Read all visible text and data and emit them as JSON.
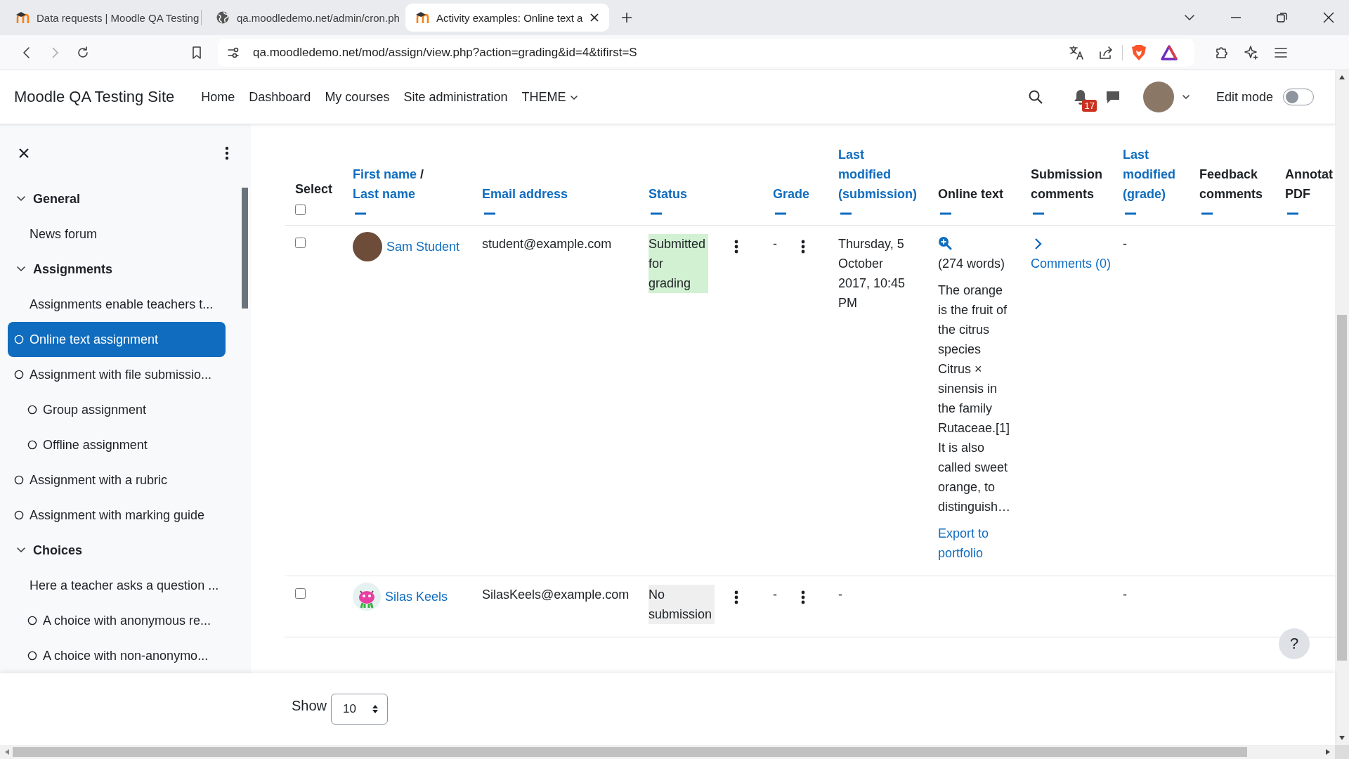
{
  "browser": {
    "tabs": [
      {
        "title": "Data requests | Moodle QA Testing",
        "kind": "moodle",
        "selected": false
      },
      {
        "title": "qa.moodledemo.net/admin/cron.ph",
        "kind": "globe",
        "selected": false
      },
      {
        "title": "Activity examples: Online text a",
        "kind": "moodle",
        "selected": true
      }
    ],
    "url": "qa.moodledemo.net/mod/assign/view.php?action=grading&id=4&tifirst=S"
  },
  "header": {
    "site_name": "Moodle QA Testing Site",
    "nav": [
      {
        "label": "Home",
        "kind": "link"
      },
      {
        "label": "Dashboard",
        "kind": "link"
      },
      {
        "label": "My courses",
        "kind": "link"
      },
      {
        "label": "Site administration",
        "kind": "link"
      },
      {
        "label": "THEME",
        "kind": "dropdown"
      }
    ],
    "notification_count": "17",
    "edit_mode": {
      "label": "Edit mode",
      "on": false
    }
  },
  "sidebar": {
    "items": [
      {
        "label": "General",
        "kind": "section",
        "expanded": true,
        "children": [
          {
            "label": "News forum",
            "kind": "activity",
            "completion": false,
            "selected": false
          }
        ]
      },
      {
        "label": "Assignments",
        "kind": "section",
        "expanded": true,
        "children": [
          {
            "label": "Assignments enable teachers t...",
            "kind": "label",
            "selected": false
          },
          {
            "label": "Online text assignment",
            "kind": "activity",
            "completion": true,
            "selected": true
          },
          {
            "label": "Assignment with file submissio...",
            "kind": "activity",
            "completion": true,
            "selected": false,
            "children": [
              {
                "label": "Group assignment",
                "kind": "activity",
                "completion": true,
                "selected": false
              },
              {
                "label": "Offline assignment",
                "kind": "activity",
                "completion": true,
                "selected": false
              }
            ]
          },
          {
            "label": "Assignment with a rubric",
            "kind": "activity",
            "completion": true,
            "selected": false
          },
          {
            "label": "Assignment with marking guide",
            "kind": "activity",
            "completion": true,
            "selected": false
          }
        ]
      },
      {
        "label": "Choices",
        "kind": "section",
        "expanded": true,
        "children": [
          {
            "label": "Here a teacher asks a question ...",
            "kind": "label",
            "selected": false,
            "children": [
              {
                "label": "A choice with anonymous re...",
                "kind": "activity",
                "completion": true,
                "selected": false
              },
              {
                "label": "A choice with non-anonymo...",
                "kind": "activity",
                "completion": true,
                "selected": false
              }
            ]
          }
        ]
      }
    ]
  },
  "table": {
    "columns": [
      {
        "kind": "select",
        "label": "Select",
        "checked": false
      },
      {
        "kind": "name",
        "links": [
          "First name",
          "Last name"
        ],
        "separator": "/"
      },
      {
        "kind": "email",
        "label": "Email address",
        "sortable": true
      },
      {
        "kind": "status",
        "label": "Status",
        "sortable": true
      },
      {
        "kind": "grade",
        "label": "Grade",
        "sortable": true
      },
      {
        "kind": "modified",
        "label": "Last modified (submission)",
        "sortable": true
      },
      {
        "kind": "onlinetext",
        "label": "Online text",
        "sortable": false
      },
      {
        "kind": "comments",
        "label": "Submission comments",
        "sortable": false
      },
      {
        "kind": "gradetime",
        "label": "Last modified (grade)",
        "sortable": true
      },
      {
        "kind": "feedback",
        "label": "Feedback comments",
        "sortable": false
      },
      {
        "kind": "pdf",
        "label": "Annotat PDF",
        "sortable": false
      }
    ],
    "rows": [
      {
        "selected": false,
        "avatar": {
          "kind": "photo"
        },
        "name": "Sam Student",
        "email": "student@example.com",
        "status": {
          "text": "Submitted for grading",
          "kind": "submitted"
        },
        "grade": "-",
        "modified": "Thursday, 5 October 2017, 10:45 PM",
        "online_text": {
          "words": "(274 words)",
          "excerpt": "The orange is the fruit of the citrus species Citrus × sinensis in the family Rutaceae.[1] It is also called sweet orange, to distinguish…",
          "export": "Export to portfolio"
        },
        "comments": "Comments (0)",
        "grade_modified": "-"
      },
      {
        "selected": false,
        "avatar": {
          "kind": "monster"
        },
        "name": "Silas Keels",
        "email": "SilasKeels@example.com",
        "status": {
          "text": "No submission",
          "kind": "none"
        },
        "grade": "-",
        "modified": "-",
        "grade_modified": "-"
      }
    ]
  },
  "footer": {
    "show_label": "Show",
    "per_page": "10"
  },
  "help_button": "?"
}
